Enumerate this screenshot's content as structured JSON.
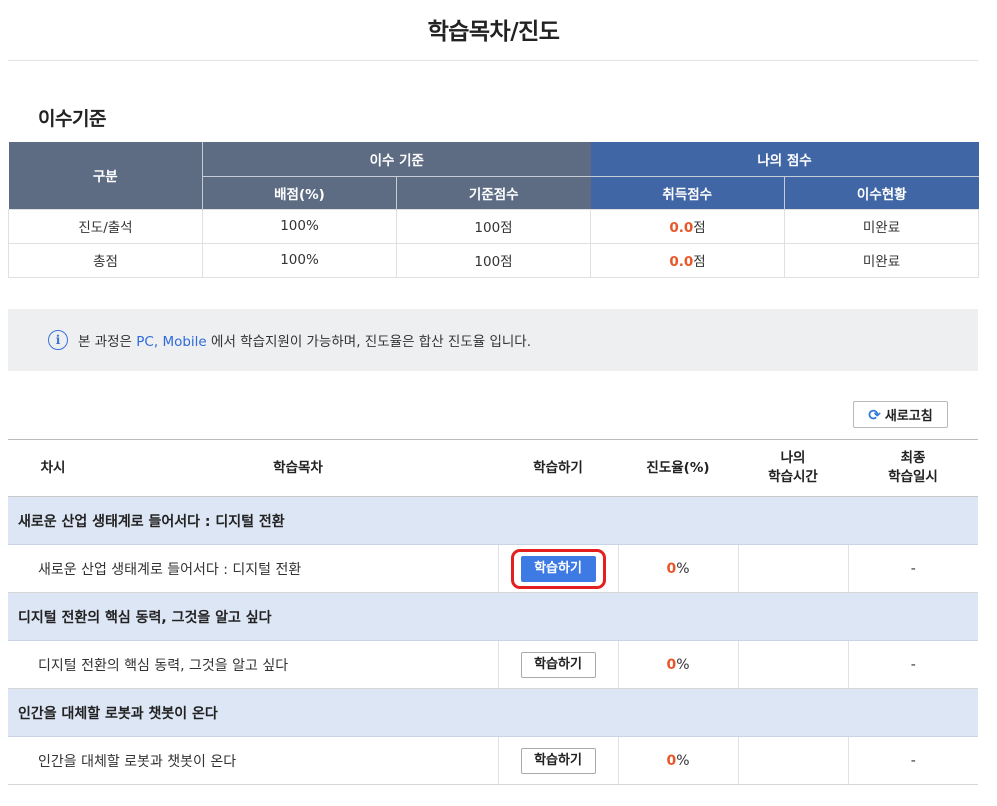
{
  "page": {
    "title": "학습목차/진도"
  },
  "criteria": {
    "section_title": "이수기준",
    "headers": {
      "category": "구분",
      "criteria_group": "이수 기준",
      "my_score_group": "나의 점수",
      "weight": "배점(%)",
      "base_score": "기준점수",
      "earned_score": "취득점수",
      "status": "이수현황"
    },
    "rows": [
      {
        "category": "진도/출석",
        "weight": "100%",
        "base": "100점",
        "earned_num": "0.0",
        "earned_unit": "점",
        "status": "미완료"
      },
      {
        "category": "총점",
        "weight": "100%",
        "base": "100점",
        "earned_num": "0.0",
        "earned_unit": "점",
        "status": "미완료"
      }
    ]
  },
  "info": {
    "icon": "info-icon",
    "text_prefix": "본 과정은 ",
    "pc": "PC",
    "sep": ", ",
    "mobile": "Mobile",
    "text_suffix": " 에서 학습지원이 가능하며, 진도율은 합산 진도율 입니다."
  },
  "refresh": {
    "label": "새로고침",
    "icon": "refresh-icon"
  },
  "toc": {
    "headers": {
      "round": "차시",
      "contents": "학습목차",
      "study": "학습하기",
      "progress": "진도율(%)",
      "my_time_line1": "나의",
      "my_time_line2": "학습시간",
      "last_line1": "최종",
      "last_line2": "학습일시"
    },
    "groups": [
      {
        "title": "새로운 산업 생태계로 들어서다 : 디지털 전환",
        "lesson": "새로운 산업 생태계로 들어서다 : 디지털 전환",
        "button": "학습하기",
        "progress_num": "0",
        "progress_unit": "%",
        "my_time": "",
        "last_date": "-"
      },
      {
        "title": "디지털 전환의 핵심 동력, 그것을 알고 싶다",
        "lesson": "디지털 전환의 핵심 동력, 그것을 알고 싶다",
        "button": "학습하기",
        "progress_num": "0",
        "progress_unit": "%",
        "my_time": "",
        "last_date": "-"
      },
      {
        "title": "인간을 대체할 로봇과 챗봇이 온다",
        "lesson": "인간을 대체할 로봇과 챗봇이 온다",
        "button": "학습하기",
        "progress_num": "0",
        "progress_unit": "%",
        "my_time": "",
        "last_date": "-"
      }
    ]
  },
  "colors": {
    "header_slate": "#5d6c83",
    "header_blue": "#4166a5",
    "accent_orange": "#e8572a",
    "button_blue": "#3d7ae4",
    "group_row_bg": "#dde6f5",
    "highlight_red": "#e41f1f"
  }
}
